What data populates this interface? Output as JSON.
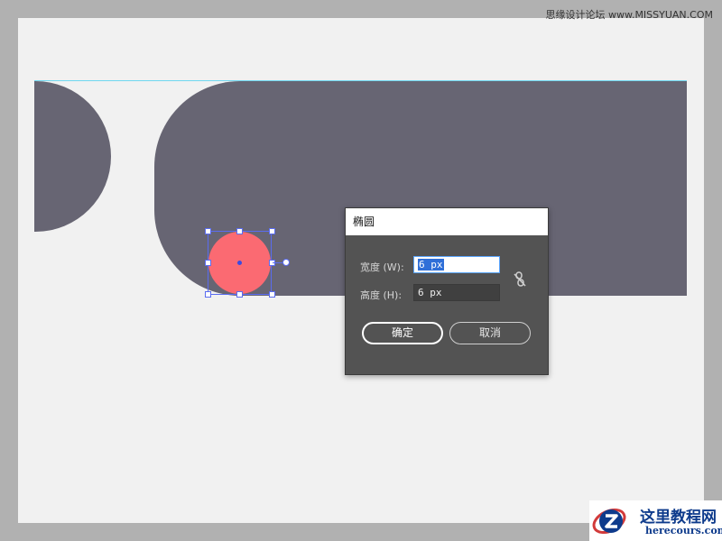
{
  "watermark_top": "思缘设计论坛 www.MISSYUAN.COM",
  "colors": {
    "canvas": "#f1f1f1",
    "shape": "#676573",
    "ellipse": "#fb6a72",
    "selection": "#5a6cf0",
    "dialog_bg": "#535353"
  },
  "dialog": {
    "title": "椭圆",
    "width_label": "宽度 (W):",
    "width_value": "6 px",
    "height_label": "高度 (H):",
    "height_value": "6 px",
    "link_icon": "unlink-icon",
    "ok_label": "确定",
    "cancel_label": "取消"
  },
  "bottom_logo": {
    "cn": "这里教程网",
    "en": "herecours.com"
  }
}
